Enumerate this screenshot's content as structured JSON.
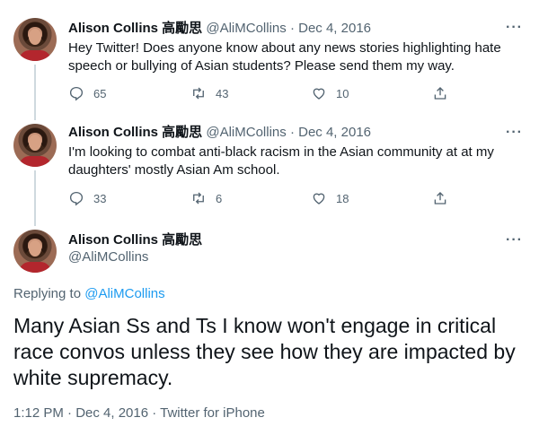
{
  "tweets": [
    {
      "name": "Alison Collins 高勵思",
      "handle": "@AliMCollins",
      "sep": " · ",
      "date": "Dec 4, 2016",
      "text": "Hey Twitter! Does anyone know about any news stories highlighting hate speech or bullying of Asian students? Please send them my way.",
      "replies": "65",
      "retweets": "43",
      "likes": "10"
    },
    {
      "name": "Alison Collins 高勵思",
      "handle": "@AliMCollins",
      "sep": " · ",
      "date": "Dec 4, 2016",
      "text": "I'm looking to combat anti-black racism in the Asian community at at my daughters' mostly Asian Am school.",
      "replies": "33",
      "retweets": "6",
      "likes": "18"
    }
  ],
  "main": {
    "name": "Alison Collins 高勵思",
    "handle": "@AliMCollins",
    "replying_prefix": "Replying to ",
    "replying_to": "@AliMCollins",
    "text": "Many Asian Ss and Ts I know won't engage in critical race convos unless they see how they are impacted by white supremacy.",
    "timestamp": "1:12 PM · Dec 4, 2016 · Twitter for iPhone"
  },
  "more_label": "···",
  "icons": {
    "reply": "reply-icon",
    "retweet": "retweet-icon",
    "like": "heart-icon",
    "share": "share-icon",
    "more": "more-icon"
  },
  "colors": {
    "link": "#1d9bf0",
    "muted": "#536471",
    "text": "#0f1419",
    "thread_line": "#cfd9de"
  }
}
